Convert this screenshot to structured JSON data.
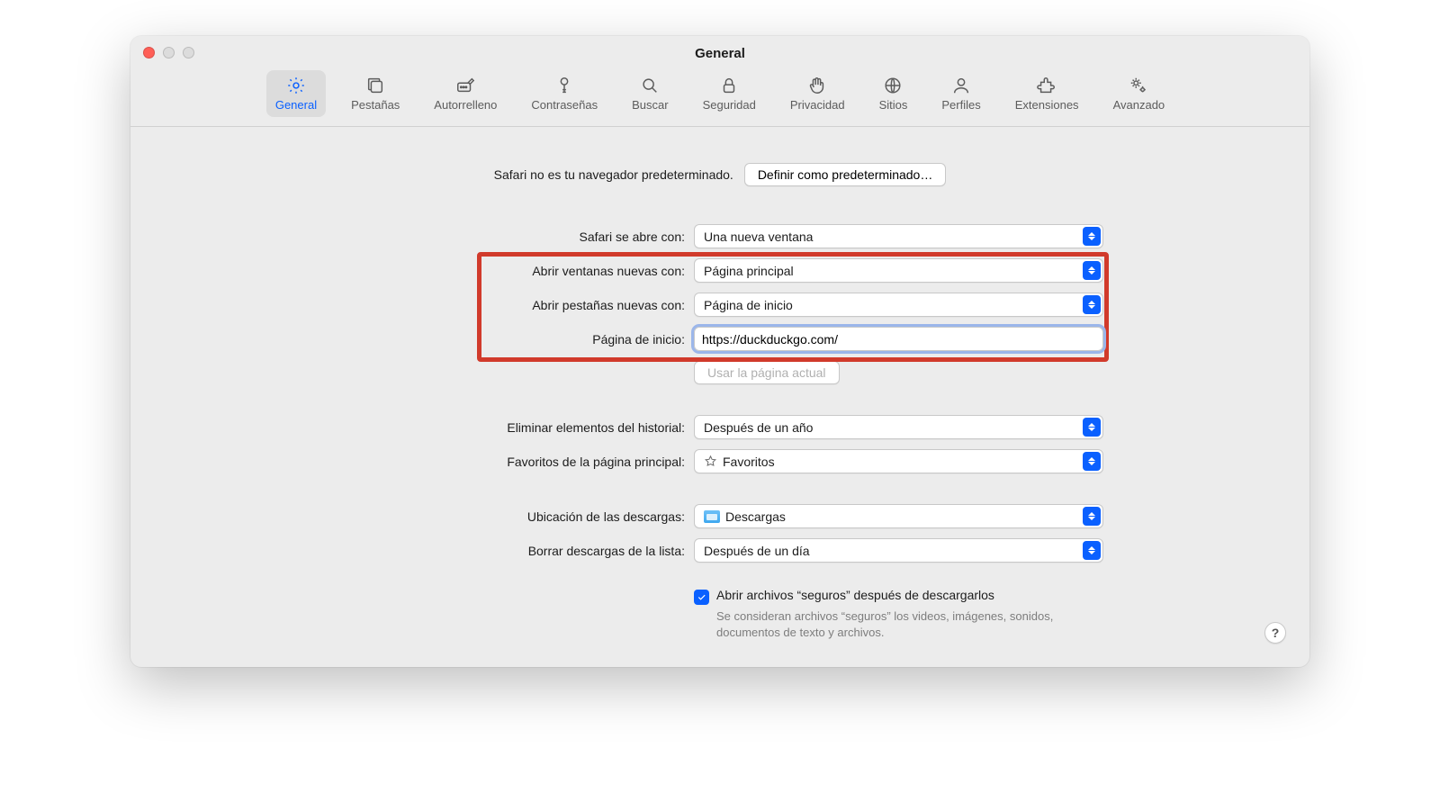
{
  "window_title": "General",
  "toolbar": [
    {
      "icon": "gear",
      "label": "General"
    },
    {
      "icon": "tabs",
      "label": "Pestañas"
    },
    {
      "icon": "autofill",
      "label": "Autorrelleno"
    },
    {
      "icon": "key",
      "label": "Contraseñas"
    },
    {
      "icon": "search",
      "label": "Buscar"
    },
    {
      "icon": "lock",
      "label": "Seguridad"
    },
    {
      "icon": "hand",
      "label": "Privacidad"
    },
    {
      "icon": "globe",
      "label": "Sitios"
    },
    {
      "icon": "person",
      "label": "Perfiles"
    },
    {
      "icon": "puzzle",
      "label": "Extensiones"
    },
    {
      "icon": "gears",
      "label": "Avanzado"
    }
  ],
  "banner": {
    "message": "Safari no es tu navegador predeterminado.",
    "button": "Definir como predeterminado…"
  },
  "fields": {
    "safari_opens": {
      "label": "Safari se abre con:",
      "value": "Una nueva ventana"
    },
    "new_windows": {
      "label": "Abrir ventanas nuevas con:",
      "value": "Página principal"
    },
    "new_tabs": {
      "label": "Abrir pestañas nuevas con:",
      "value": "Página de inicio"
    },
    "homepage": {
      "label": "Página de inicio:",
      "value": "https://duckduckgo.com/"
    },
    "use_current": "Usar la página actual",
    "history": {
      "label": "Eliminar elementos del historial:",
      "value": "Después de un año"
    },
    "favorites": {
      "label": "Favoritos de la página principal:",
      "value": "Favoritos"
    },
    "downloads_loc": {
      "label": "Ubicación de las descargas:",
      "value": "Descargas"
    },
    "downloads_clear": {
      "label": "Borrar descargas de la lista:",
      "value": "Después de un día"
    }
  },
  "safe_files": {
    "label": "Abrir archivos “seguros” después de descargarlos",
    "hint": "Se consideran archivos “seguros” los videos, imágenes, sonidos, documentos de texto y archivos."
  },
  "help_button": "?"
}
